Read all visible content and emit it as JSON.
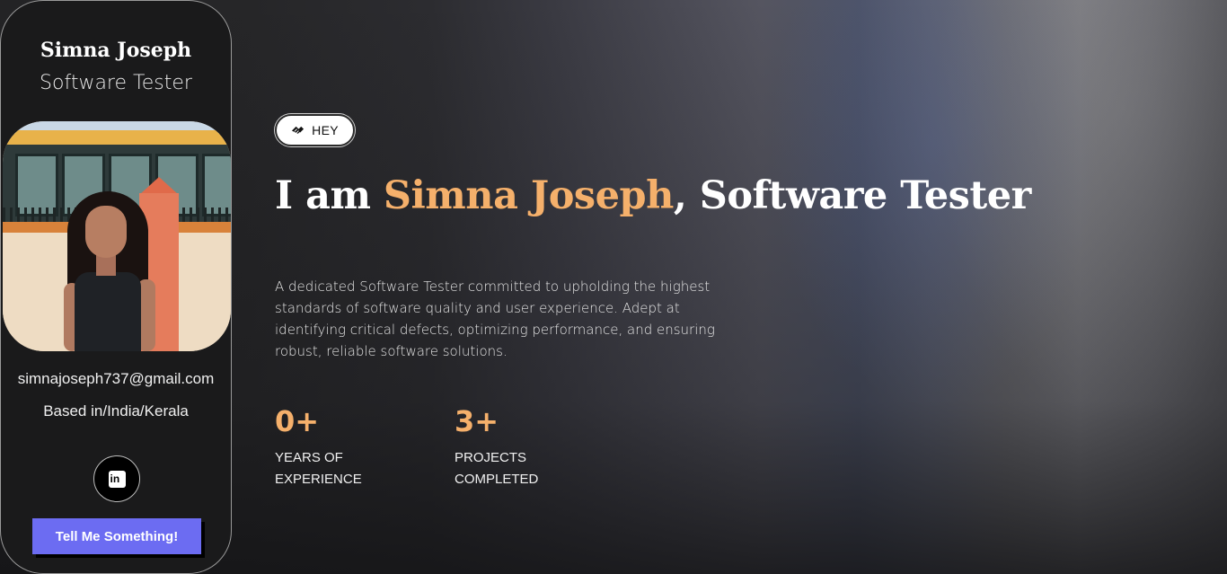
{
  "sidebar": {
    "name": "Simna Joseph",
    "role": "Software Tester",
    "email": "simnajoseph737@gmail.com",
    "location": "Based in/India/Kerala",
    "social": [
      {
        "icon": "linkedin-icon",
        "glyph": "in"
      }
    ],
    "cta_label": "Tell Me Something!"
  },
  "hero": {
    "badge_label": "HEY",
    "badge_icon": "handshake-icon",
    "headline_prefix": "I am ",
    "headline_name": "Simna Joseph",
    "headline_suffix": ", Software Tester",
    "bio": "A dedicated Software Tester committed to upholding the highest standards of software quality and user experience. Adept at identifying critical defects, optimizing performance, and ensuring robust, reliable software solutions.",
    "stats": [
      {
        "value": "0+",
        "label_line1": "YEARS OF",
        "label_line2": "EXPERIENCE"
      },
      {
        "value": "3+",
        "label_line1": "PROJECTS",
        "label_line2": "COMPLETED"
      }
    ]
  },
  "colors": {
    "accent": "#f5b06b",
    "cta": "#6c6cf2",
    "card_bg": "#1a1a1b"
  }
}
